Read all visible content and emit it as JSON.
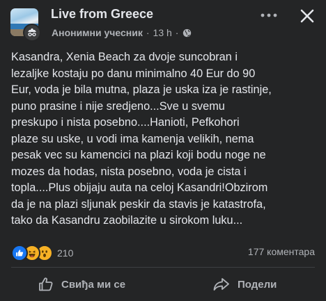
{
  "header": {
    "group_name": "Live from Greece",
    "author": "Анонимни учесник",
    "separator": "·",
    "time": "13 h",
    "dot": "·",
    "privacy_icon": "globe-icon",
    "more_icon": "more-horizontal-icon",
    "close_icon": "close-icon"
  },
  "post": {
    "lines": [
      "Kasandra, Xenia Beach za dvoje suncobran i",
      "lezaljke kostaju po danu minimalno 40 Eur do 90",
      "Eur, voda je bila mutna, plaza je uska iza je rastinje,",
      "puno prasine i nije sredjeno...Sve u svemu",
      "preskupo i nista posebno....Hanioti, Pefkohori",
      "plaze su uske, u vodi ima kamenja velikih, nema",
      "pesak vec su kamencici na plazi koji bodu noge ne",
      "mozes da hodas, nista posebno, voda je cista i",
      "topla....Plus obijaju auta na celoj Kasandri!Obzirom",
      "da je na plazi sljunak peskir da stavis je katastrofa,",
      "tako da Kasandru zaobilazite u sirokom luku..."
    ]
  },
  "stats": {
    "reaction_icons": [
      "like-reaction-icon",
      "haha-reaction-icon",
      "wow-reaction-icon"
    ],
    "reaction_count": "210",
    "comments": "177 коментара"
  },
  "actions": {
    "like_label": "Свиђа ми се",
    "share_label": "Подели"
  },
  "colors": {
    "background": "#242526",
    "text_primary": "#e4e6eb",
    "text_secondary": "#b0b3b8",
    "like_blue": "#1877f2",
    "emoji_yellow": "#f7b125"
  }
}
